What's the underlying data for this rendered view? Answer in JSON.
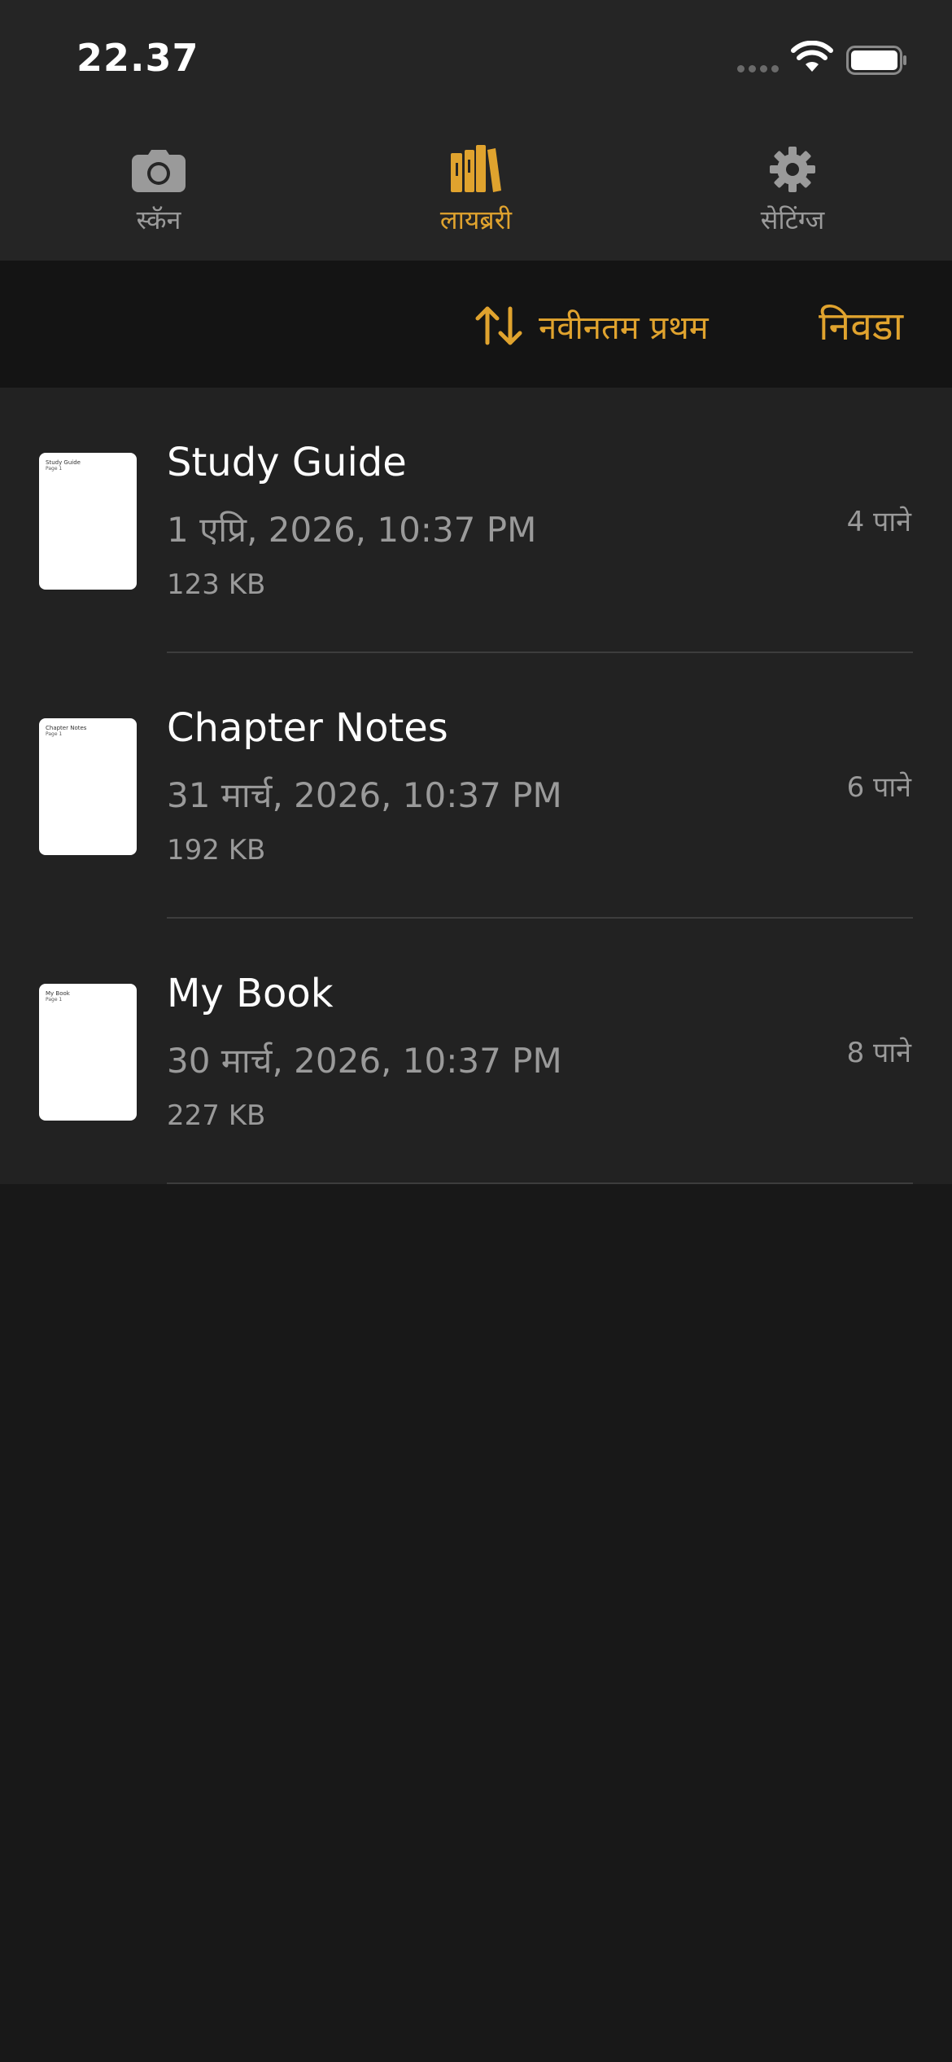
{
  "status_bar": {
    "time": "22.37"
  },
  "tabs": [
    {
      "label": "स्कॅन",
      "icon": "camera-icon",
      "active": false
    },
    {
      "label": "लायब्ररी",
      "icon": "library-books-icon",
      "active": true
    },
    {
      "label": "सेटिंग्ज",
      "icon": "gear-icon",
      "active": false
    }
  ],
  "toolbar": {
    "sort_icon": "sort-arrows-icon",
    "sort_label": "नवीनतम प्रथम",
    "select_label": "निवडा"
  },
  "documents": [
    {
      "title": "Study Guide",
      "thumb_title": "Study Guide",
      "thumb_sub": "Page 1",
      "date": "1 एप्रि, 2026, 10:37 PM",
      "size": "123 KB",
      "pages": "4 पाने"
    },
    {
      "title": "Chapter Notes",
      "thumb_title": "Chapter Notes",
      "thumb_sub": "Page 1",
      "date": "31 मार्च, 2026, 10:37 PM",
      "size": "192 KB",
      "pages": "6 पाने"
    },
    {
      "title": "My Book",
      "thumb_title": "My Book",
      "thumb_sub": "Page 1",
      "date": "30 मार्च, 2026, 10:37 PM",
      "size": "227 KB",
      "pages": "8 पाने"
    }
  ],
  "colors": {
    "accent": "#e0a32e",
    "background": "#181818",
    "bar_background": "#252525",
    "list_background": "#222222",
    "secondary_text": "#9a9a9a"
  }
}
